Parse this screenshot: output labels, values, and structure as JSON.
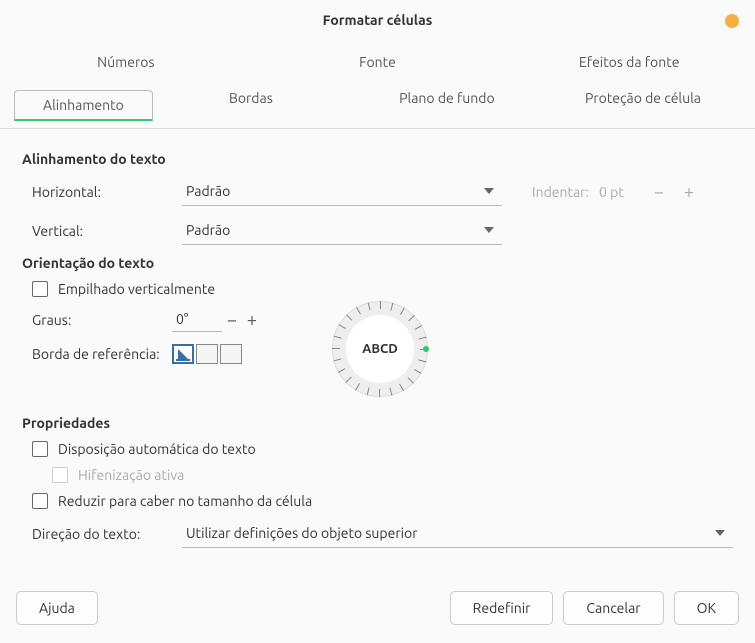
{
  "title": "Formatar células",
  "topTabs": {
    "t0": "Números",
    "t1": "Fonte",
    "t2": "Efeitos da fonte"
  },
  "subTabs": {
    "active": "Alinhamento",
    "t1": "Bordas",
    "t2": "Plano de fundo",
    "t3": "Proteção de célula"
  },
  "sections": {
    "align": "Alinhamento do texto",
    "orient": "Orientação do texto",
    "props": "Propriedades"
  },
  "align": {
    "hLabel": "Horizontal:",
    "hValue": "Padrão",
    "vLabel": "Vertical:",
    "vValue": "Padrão",
    "indentLabel": "Indentar:",
    "indentValue": "0 pt"
  },
  "orient": {
    "stacked": "Empilhado verticalmente",
    "degreesLabel": "Graus:",
    "degreesValue": "0°",
    "refLabel": "Borda de referência:",
    "dialText": "ABCD"
  },
  "props": {
    "wrap": "Disposição automática do texto",
    "hyphen": "Hifenização ativa",
    "shrink": "Reduzir para caber no tamanho da célula",
    "dirLabel": "Direção do texto:",
    "dirValue": "Utilizar definições do objeto superior"
  },
  "buttons": {
    "help": "Ajuda",
    "reset": "Redefinir",
    "cancel": "Cancelar",
    "ok": "OK"
  }
}
